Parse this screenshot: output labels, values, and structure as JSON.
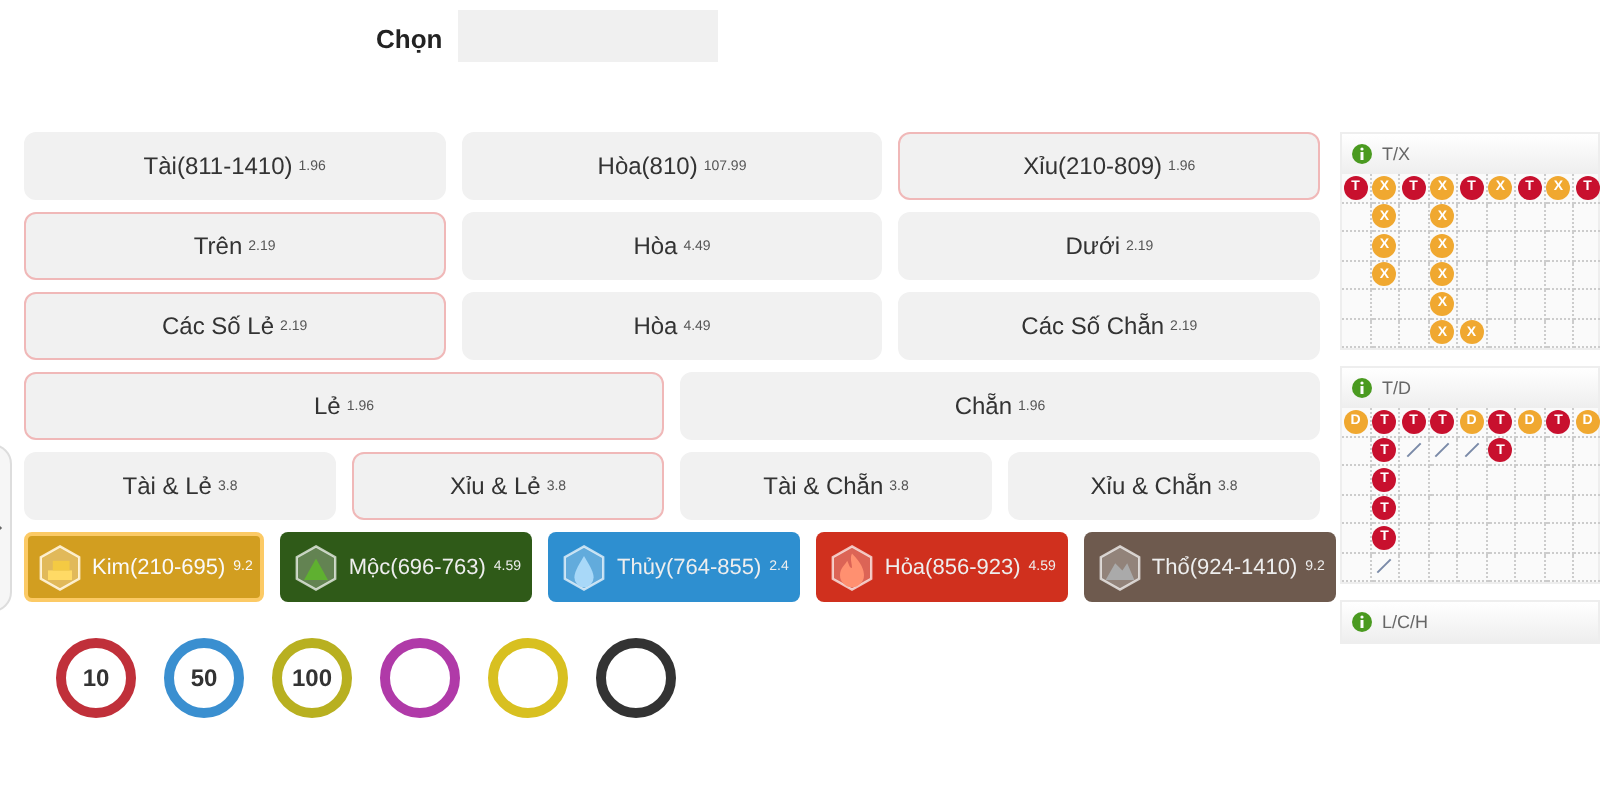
{
  "top_bar": {
    "tab": "Chọn"
  },
  "bet_rows": [
    [
      {
        "label": "Tài(811-1410)",
        "odds": "1.96",
        "selected": false
      },
      {
        "label": "Hòa(810)",
        "odds": "107.99",
        "selected": false
      },
      {
        "label": "Xỉu(210-809)",
        "odds": "1.96",
        "selected": true
      }
    ],
    [
      {
        "label": "Trên",
        "odds": "2.19",
        "selected": true
      },
      {
        "label": "Hòa",
        "odds": "4.49",
        "selected": false
      },
      {
        "label": "Dưới",
        "odds": "2.19",
        "selected": false
      }
    ],
    [
      {
        "label": "Các Số Lẻ",
        "odds": "2.19",
        "selected": true
      },
      {
        "label": "Hòa",
        "odds": "4.49",
        "selected": false
      },
      {
        "label": "Các Số Chẵn",
        "odds": "2.19",
        "selected": false
      }
    ],
    [
      {
        "label": "Lẻ",
        "odds": "1.96",
        "selected": true
      },
      {
        "label": "Chẵn",
        "odds": "1.96",
        "selected": false
      }
    ],
    [
      {
        "label": "Tài & Lẻ",
        "odds": "3.8",
        "selected": false
      },
      {
        "label": "Xỉu & Lẻ",
        "odds": "3.8",
        "selected": true
      },
      {
        "label": "Tài & Chẵn",
        "odds": "3.8",
        "selected": false
      },
      {
        "label": "Xỉu & Chẵn",
        "odds": "3.8",
        "selected": false
      }
    ]
  ],
  "elements": [
    {
      "kind": "metal",
      "label": "Kim(210-695)",
      "odds": "9.2",
      "color": "#c8961e",
      "selected": true
    },
    {
      "kind": "wood",
      "label": "Mộc(696-763)",
      "odds": "4.59",
      "color": "#2f5a18",
      "selected": false
    },
    {
      "kind": "water",
      "label": "Thủy(764-855)",
      "odds": "2.4",
      "color": "#2e8fd0",
      "selected": false
    },
    {
      "kind": "fire",
      "label": "Hỏa(856-923)",
      "odds": "4.59",
      "color": "#d0301e",
      "selected": false
    },
    {
      "kind": "earth",
      "label": "Thổ(924-1410)",
      "odds": "9.2",
      "color": "#6e5a4e",
      "selected": false
    }
  ],
  "chips": [
    {
      "label": "10",
      "color": "#c0303a"
    },
    {
      "label": "50",
      "color": "#3a8fd0"
    },
    {
      "label": "100",
      "color": "#b8b020"
    },
    {
      "color": "#b03aa8"
    },
    {
      "color": "#d8c020"
    },
    {
      "color": "#333333"
    }
  ],
  "roads": [
    {
      "title": "T/X",
      "rows": [
        [
          {
            "kind": "bead",
            "text": "T",
            "color": "#c8102e"
          },
          {
            "kind": "bead",
            "text": "X",
            "color": "#f0a830"
          },
          {
            "kind": "bead",
            "text": "T",
            "color": "#c8102e"
          },
          {
            "kind": "bead",
            "text": "X",
            "color": "#f0a830"
          },
          {
            "kind": "bead",
            "text": "T",
            "color": "#c8102e"
          },
          {
            "kind": "bead",
            "text": "X",
            "color": "#f0a830"
          },
          {
            "kind": "bead",
            "text": "T",
            "color": "#c8102e"
          },
          {
            "kind": "bead",
            "text": "X",
            "color": "#f0a830"
          },
          {
            "kind": "bead",
            "text": "T",
            "color": "#c8102e"
          }
        ],
        [
          null,
          {
            "kind": "bead",
            "text": "X",
            "color": "#f0a830"
          },
          null,
          {
            "kind": "bead",
            "text": "X",
            "color": "#f0a830"
          },
          null,
          null,
          null,
          null,
          null
        ],
        [
          null,
          {
            "kind": "bead",
            "text": "X",
            "color": "#f0a830"
          },
          null,
          {
            "kind": "bead",
            "text": "X",
            "color": "#f0a830"
          },
          null,
          null,
          null,
          null,
          null
        ],
        [
          null,
          {
            "kind": "bead",
            "text": "X",
            "color": "#f0a830"
          },
          null,
          {
            "kind": "bead",
            "text": "X",
            "color": "#f0a830"
          },
          null,
          null,
          null,
          null,
          null
        ],
        [
          null,
          null,
          null,
          {
            "kind": "bead",
            "text": "X",
            "color": "#f0a830"
          },
          null,
          null,
          null,
          null,
          null
        ],
        [
          null,
          null,
          null,
          {
            "kind": "bead",
            "text": "X",
            "color": "#f0a830"
          },
          {
            "kind": "bead",
            "text": "X",
            "color": "#f0a830"
          },
          null,
          null,
          null,
          null
        ]
      ]
    },
    {
      "title": "T/D",
      "rows": [
        [
          {
            "kind": "bead",
            "text": "D",
            "color": "#f0a830"
          },
          {
            "kind": "bead",
            "text": "T",
            "color": "#c8102e"
          },
          {
            "kind": "bead",
            "text": "T",
            "color": "#c8102e"
          },
          {
            "kind": "bead",
            "text": "T",
            "color": "#c8102e"
          },
          {
            "kind": "bead",
            "text": "D",
            "color": "#f0a830"
          },
          {
            "kind": "bead",
            "text": "T",
            "color": "#c8102e"
          },
          {
            "kind": "bead",
            "text": "D",
            "color": "#f0a830"
          },
          {
            "kind": "bead",
            "text": "T",
            "color": "#c8102e"
          },
          {
            "kind": "bead",
            "text": "D",
            "color": "#f0a830"
          }
        ],
        [
          null,
          {
            "kind": "bead",
            "text": "T",
            "color": "#c8102e"
          },
          {
            "kind": "tie"
          },
          {
            "kind": "tie"
          },
          {
            "kind": "tie"
          },
          {
            "kind": "bead",
            "text": "T",
            "color": "#c8102e"
          },
          null,
          null,
          null
        ],
        [
          null,
          {
            "kind": "bead",
            "text": "T",
            "color": "#c8102e"
          },
          null,
          null,
          null,
          null,
          null,
          null,
          null
        ],
        [
          null,
          {
            "kind": "bead",
            "text": "T",
            "color": "#c8102e"
          },
          null,
          null,
          null,
          null,
          null,
          null,
          null
        ],
        [
          null,
          {
            "kind": "bead",
            "text": "T",
            "color": "#c8102e"
          },
          null,
          null,
          null,
          null,
          null,
          null,
          null
        ],
        [
          null,
          {
            "kind": "tie"
          },
          null,
          null,
          null,
          null,
          null,
          null,
          null
        ]
      ]
    },
    {
      "title": "L/C/H"
    }
  ]
}
